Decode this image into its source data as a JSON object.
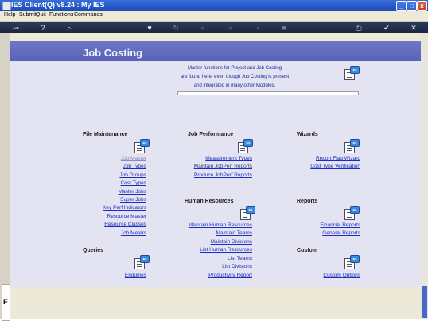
{
  "window": {
    "title": "IES Client(Q) v8.24 : My IES",
    "minimize": "_",
    "maximize": "□",
    "close": "x"
  },
  "menu": [
    "Help",
    "Submit",
    "Quit",
    "Functions",
    "Commands"
  ],
  "toolbar": {
    "icons": [
      "key-icon",
      "help-icon",
      "search-icon",
      "heart-icon",
      "refresh-icon",
      "first-icon",
      "last-icon",
      "prev-icon",
      "next-icon",
      "bookmark-icon",
      "stop-icon",
      "print-icon",
      "check-icon",
      "close-icon"
    ]
  },
  "page": {
    "title": "Job Costing",
    "intro": [
      "Master functions for Project and Job Costing",
      "are found here, even though Job Costing is present",
      "and integrated in many other Modules."
    ],
    "left_strip_letter": "E"
  },
  "sections": {
    "file_maintenance": {
      "title": "File Maintenance",
      "links": [
        "Job Master",
        "Job Types",
        "Job Groups",
        "Cost Types",
        "Master Jobs",
        "Super Jobs",
        "Key Perf Indicators",
        "Resource Master",
        "Resource Classes",
        "Job Meters"
      ]
    },
    "job_performance": {
      "title": "Job Performance",
      "links": [
        "Measurement Types",
        "Maintain JobPerf Reports",
        "Produce JobPerf Reports"
      ]
    },
    "wizards": {
      "title": "Wizards",
      "links": [
        "Report Flag Wizard",
        "Cost Type Verification"
      ]
    },
    "human_resources": {
      "title": "Human Resources",
      "links": [
        "Maintain Human Resources",
        "Maintain Teams",
        "Maintain Divisions",
        "List Human Resources",
        "List Teams",
        "List Divisions",
        "Productivity Report"
      ]
    },
    "reports": {
      "title": "Reports",
      "links": [
        "Financial Reports",
        "General Reports"
      ]
    },
    "queries": {
      "title": "Queries",
      "links": [
        "Enquiries"
      ]
    },
    "custom": {
      "title": "Custom",
      "links": [
        "Custom Options"
      ]
    }
  },
  "colors": {
    "banner": "#5a62b8",
    "link": "#1b2cc0",
    "content_bg": "#e3e3f1"
  }
}
